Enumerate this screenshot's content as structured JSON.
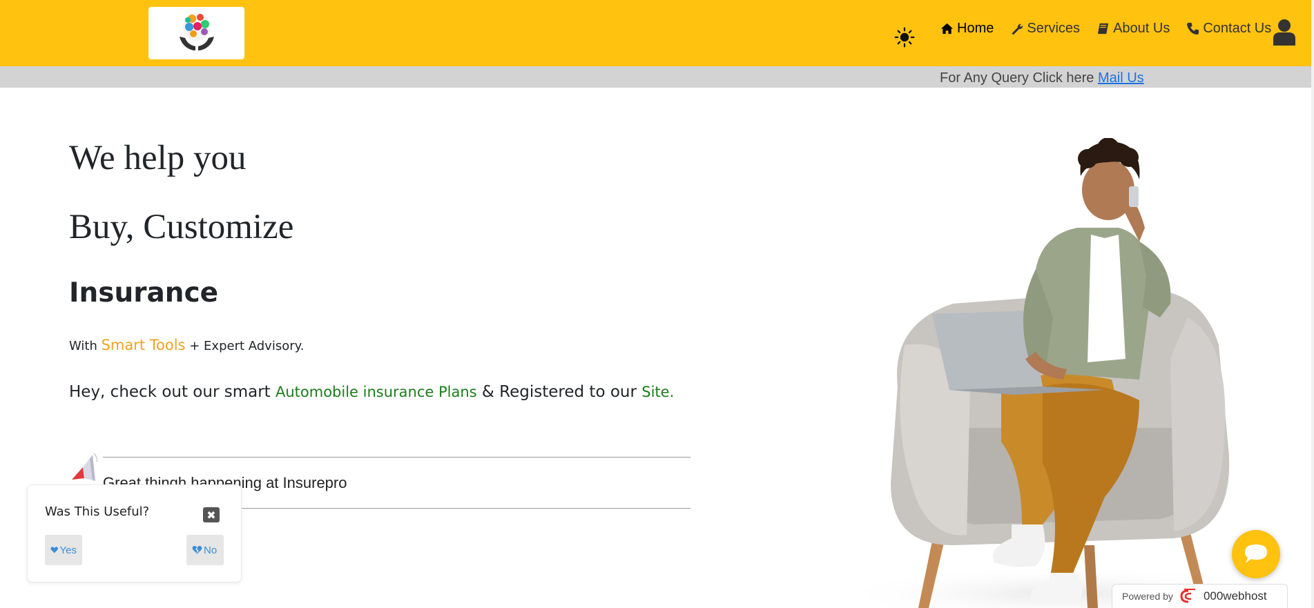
{
  "header": {
    "bg_color": "#fec20f",
    "logo_icon": "insurance-hands-logo",
    "theme_toggle_icon": "sun-icon",
    "nav": [
      {
        "label": "Home",
        "icon": "home-icon",
        "active": true
      },
      {
        "label": "Services",
        "icon": "wrench-icon",
        "active": false
      },
      {
        "label": "About Us",
        "icon": "book-icon",
        "active": false
      },
      {
        "label": "Contact Us",
        "icon": "phone-icon",
        "active": false
      }
    ],
    "user_icon": "user-icon"
  },
  "query_bar": {
    "text": "For Any Query Click here ",
    "link_label": "Mail Us"
  },
  "hero": {
    "line1": "We help you",
    "line2": "Buy, Customize",
    "line3": "Insurance",
    "tagline_pre": "With ",
    "tagline_highlight": "Smart Tools",
    "tagline_post": " + Expert Advisory.",
    "promo_pre": "Hey, check out our smart ",
    "promo_link1": "Automobile insurance Plans",
    "promo_mid": " & Registered to our ",
    "promo_link2": "Site."
  },
  "ticker": {
    "icon": "megaphone-icon",
    "text": "Great thingh happening at Insurepro"
  },
  "feedback": {
    "title": "Was This Useful?",
    "close_icon": "close-icon",
    "yes_label": "Yes",
    "no_label": "No"
  },
  "chat": {
    "icon": "chat-bubble-icon"
  },
  "powered": {
    "label": "Powered by",
    "brand": "000webhost"
  },
  "colors": {
    "accent": "#fec20f",
    "orange": "#f4a020",
    "green": "#1a7d1a",
    "link": "#1a73e8"
  }
}
